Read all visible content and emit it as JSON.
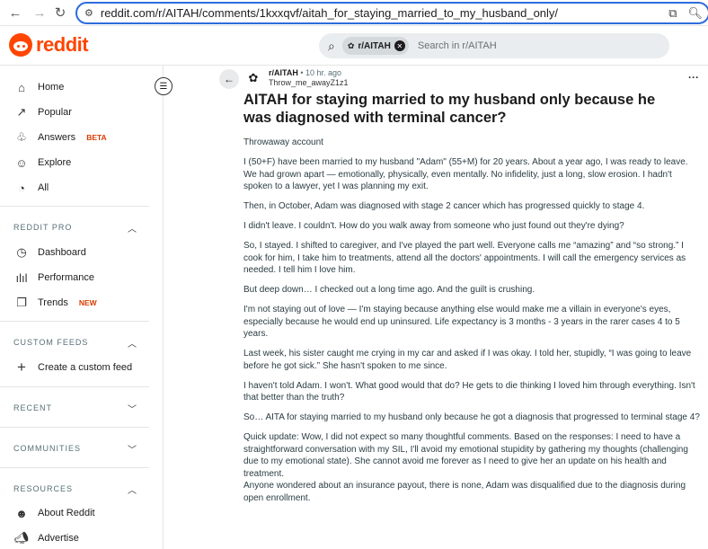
{
  "browser": {
    "url": "reddit.com/r/AITAH/comments/1kxxqvf/aitah_for_staying_married_to_my_husband_only/"
  },
  "header": {
    "logo_text": "reddit",
    "search_chip": "r/AITAH",
    "search_placeholder": "Search in r/AITAH"
  },
  "sidebar": {
    "main": [
      {
        "label": "Home",
        "icon": "home-icon"
      },
      {
        "label": "Popular",
        "icon": "popular-icon"
      },
      {
        "label": "Answers",
        "icon": "answers-icon",
        "badge": "BETA"
      },
      {
        "label": "Explore",
        "icon": "explore-icon"
      },
      {
        "label": "All",
        "icon": "all-icon"
      }
    ],
    "pro": {
      "title": "REDDIT PRO",
      "items": [
        {
          "label": "Dashboard"
        },
        {
          "label": "Performance"
        },
        {
          "label": "Trends",
          "badge": "NEW"
        }
      ]
    },
    "feeds": {
      "title": "CUSTOM FEEDS",
      "create": "Create a custom feed"
    },
    "recent": {
      "title": "RECENT"
    },
    "communities": {
      "title": "COMMUNITIES"
    },
    "resources": {
      "title": "RESOURCES",
      "items": [
        {
          "label": "About Reddit"
        },
        {
          "label": "Advertise"
        }
      ]
    }
  },
  "post": {
    "subreddit": "r/AITAH",
    "age": "10 hr. ago",
    "author": "Throw_me_awayZ1z1",
    "title": "AITAH for staying married to my husband only because he was diagnosed with terminal cancer?",
    "paragraphs": [
      "Throwaway account",
      "I (50+F) have been married to my husband \"Adam\" (55+M) for 20 years. About a year ago, I was ready to leave. We had grown apart — emotionally, physically, even mentally. No infidelity, just a long, slow erosion. I hadn't spoken to a lawyer, yet I was planning my exit.",
      "Then, in October, Adam was diagnosed with stage 2 cancer which has progressed quickly to stage 4.",
      "I didn't leave. I couldn't. How do you walk away from someone who just found out they're dying?",
      "So, I stayed. I shifted to caregiver, and I've played the part well. Everyone calls me “amazing” and “so strong.” I cook for him, I take him to treatments, attend all the doctors' appointments. I will call the emergency services as needed. I tell him I love him.",
      "But deep down… I checked out a long time ago. And the guilt is crushing.",
      "I'm not staying out of love — I'm staying because anything else would make me a villain in everyone's eyes, especially because he would end up uninsured. Life expectancy is 3 months - 3 years in the rarer cases 4 to 5 years.",
      "Last week, his sister caught me crying in my car and asked if I was okay. I told her, stupidly, “I was going to leave before he got sick.” She hasn't spoken to me since.",
      "I haven't told Adam. I won't. What good would that do? He gets to die thinking I loved him through everything. Isn't that better than the truth?",
      "So… AITA for staying married to my husband only because he got a diagnosis that progressed to terminal stage 4?",
      "Quick update: Wow, I did not expect so many thoughtful comments. Based on the responses: I need to have a straightforward conversation with my SIL, I'll avoid my emotional stupidity by gathering my thoughts (challenging due to my emotional state). She cannot avoid me forever as I need to give her an update on his health and treatment.",
      "Anyone wondered about an insurance payout, there is none, Adam was disqualified due to the diagnosis during open enrollment."
    ]
  }
}
